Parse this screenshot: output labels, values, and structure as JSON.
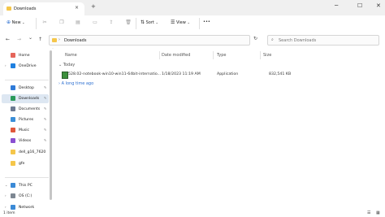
{
  "window": {
    "tab_title": "Downloads",
    "new_tab_symbol": "+",
    "close_tab_symbol": "×",
    "minimize_symbol": "─",
    "maximize_symbol": "☐",
    "close_symbol": "✕"
  },
  "toolbar": {
    "new_label": "New",
    "sort_label": "Sort",
    "view_label": "View",
    "more_label": "•••"
  },
  "nav": {
    "back": "←",
    "forward": "→",
    "recent": "⌄",
    "up": "↑",
    "breadcrumb_sep": "›",
    "address_text": "Downloads",
    "refresh": "↻",
    "search_placeholder": "Search Downloads",
    "search_icon": "⌕"
  },
  "sidebar": {
    "items": [
      {
        "label": "Home",
        "icon": "home-icon",
        "color": "#e5655a",
        "pinned": false,
        "expand": ""
      },
      {
        "label": "OneDrive",
        "icon": "cloud-icon",
        "color": "#1f80e0",
        "pinned": false,
        "expand": "›"
      },
      {
        "label": "Desktop",
        "icon": "desktop-icon",
        "color": "#2e7ad8",
        "pinned": true,
        "expand": ""
      },
      {
        "label": "Downloads",
        "icon": "download-icon",
        "color": "#2a9a5a",
        "pinned": true,
        "expand": "",
        "selected": true
      },
      {
        "label": "Documents",
        "icon": "document-icon",
        "color": "#6c7a92",
        "pinned": true,
        "expand": ""
      },
      {
        "label": "Pictures",
        "icon": "picture-icon",
        "color": "#3a8fd8",
        "pinned": true,
        "expand": ""
      },
      {
        "label": "Music",
        "icon": "music-icon",
        "color": "#e0583c",
        "pinned": true,
        "expand": ""
      },
      {
        "label": "Videos",
        "icon": "video-icon",
        "color": "#8a4fd1",
        "pinned": true,
        "expand": ""
      },
      {
        "label": "dell_g16_7620",
        "icon": "folder-icon",
        "color": "#f5c64a",
        "pinned": false,
        "expand": ""
      },
      {
        "label": "gfe",
        "icon": "folder-icon",
        "color": "#f5c64a",
        "pinned": false,
        "expand": ""
      },
      {
        "label": "This PC",
        "icon": "computer-icon",
        "color": "#3b8ad6",
        "pinned": false,
        "expand": "⌄"
      },
      {
        "label": "OS (C:)",
        "icon": "drive-icon",
        "color": "#7d8792",
        "pinned": false,
        "expand": "›"
      },
      {
        "label": "Network",
        "icon": "network-icon",
        "color": "#3b8ad6",
        "pinned": false,
        "expand": "›"
      }
    ],
    "pin_symbol": "✎"
  },
  "columns": {
    "name": "Name",
    "date": "Date modified",
    "type": "Type",
    "size": "Size"
  },
  "groups": {
    "today": "Today",
    "today_chevron": "⌄",
    "long_ago": "A long time ago",
    "long_ago_chevron": "›"
  },
  "files": [
    {
      "name": "528.02-notebook-win10-win11-64bit-internatio...",
      "date": "1/18/2023 11:19 AM",
      "type": "Application",
      "size": "832,541 KB"
    }
  ],
  "status": {
    "item_count": "1 item"
  }
}
